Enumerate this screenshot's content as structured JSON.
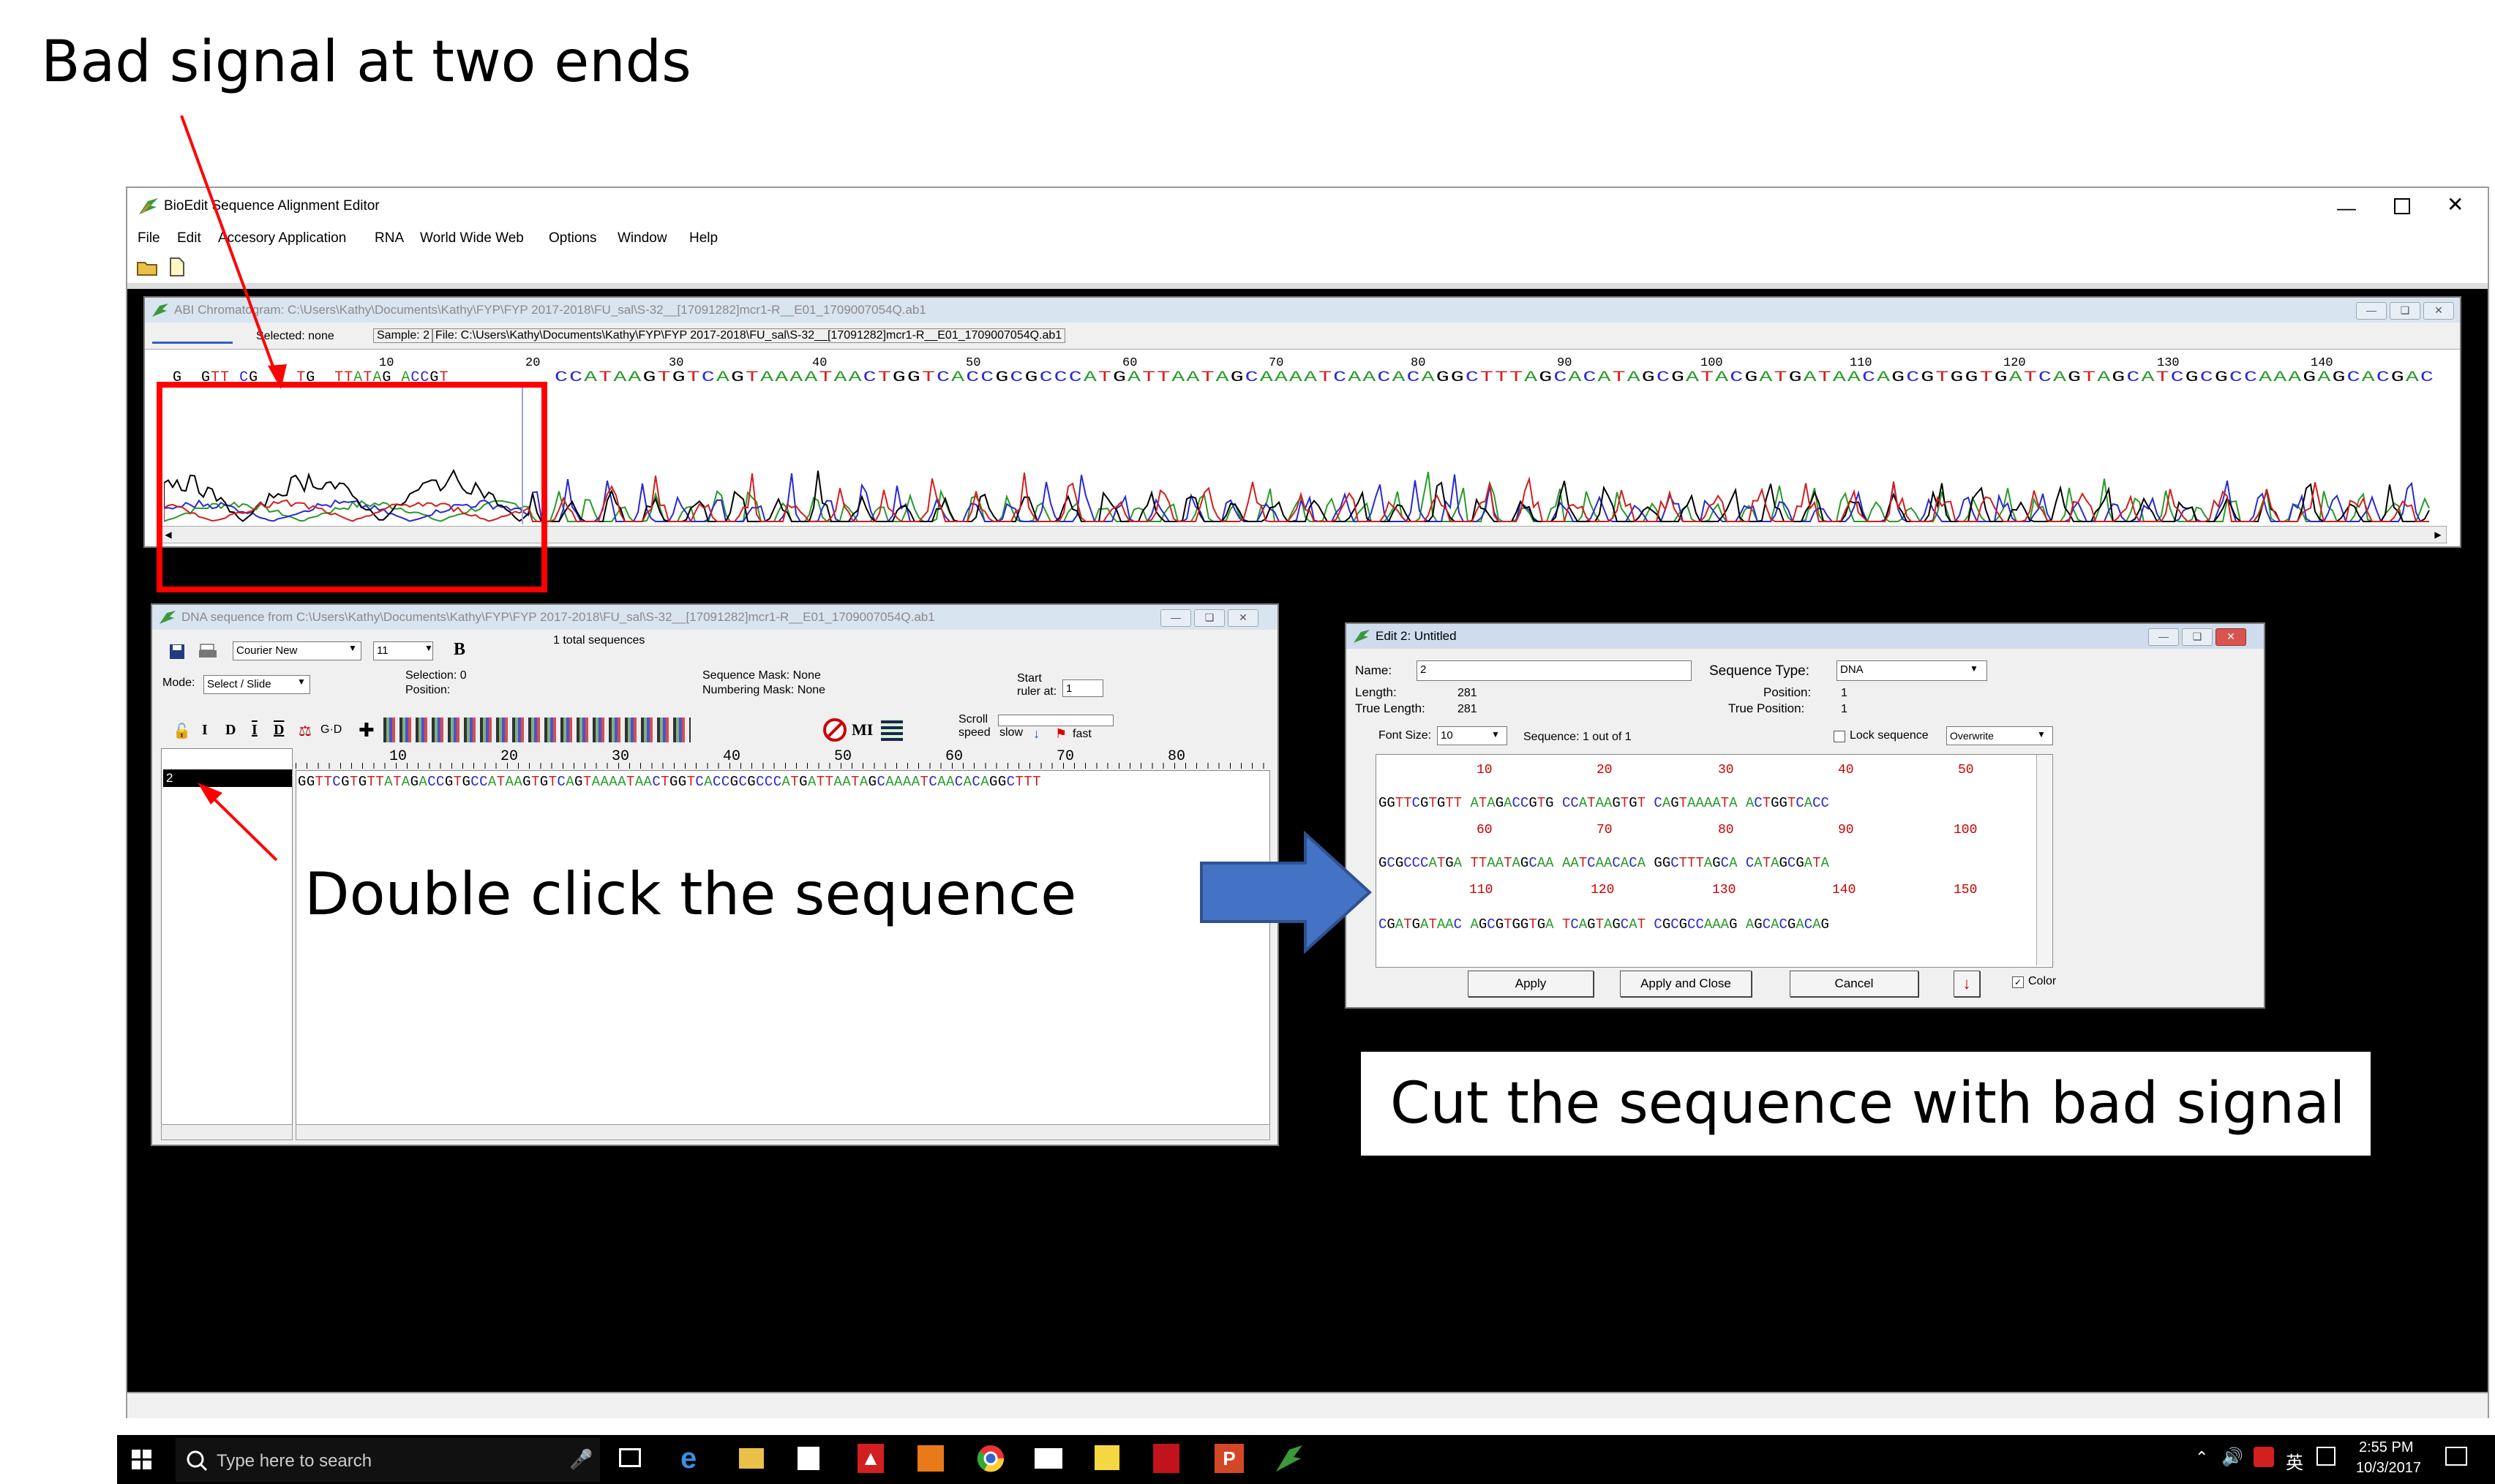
{
  "annotations": {
    "top_left": "Bad signal at two ends",
    "double_click": "Double click the sequence",
    "cut": "Cut the sequence with bad signal"
  },
  "app": {
    "title": "BioEdit Sequence Alignment Editor",
    "menu": [
      "File",
      "Edit",
      "Accesory Application",
      "RNA",
      "World Wide Web",
      "Options",
      "Window",
      "Help"
    ]
  },
  "chromatogram": {
    "title": "ABI Chromatogram: C:\\Users\\Kathy\\Documents\\Kathy\\FYP\\FYP 2017-2018\\FU_sal\\S-32__[17091282]mcr1-R__E01_1709007054Q.ab1",
    "selected": "Selected: none",
    "sample": "Sample: 2",
    "file": "File: C:\\Users\\Kathy\\Documents\\Kathy\\FYP\\FYP 2017-2018\\FU_sal\\S-32__[17091282]mcr1-R__E01_1709007054Q.ab1",
    "ticks": [
      "10",
      "20",
      "30",
      "40",
      "50",
      "60",
      "70",
      "80",
      "90",
      "100",
      "110",
      "120",
      "130",
      "140"
    ],
    "bases_left": "G  GTT CG    TG  TTATAG ACCGT",
    "bases_main": "CCATAAGTGTCAGTAAAATAACTGGTCACCGCGCCCATGATTAATAGCAAAATCAACACAGGCTTTAGCACATAGCGATACGATGATAACAGCGTGGTGATCAGTAGCATCGCGCCAAAGAGCACGAC"
  },
  "dna_window": {
    "title": "DNA sequence from C:\\Users\\Kathy\\Documents\\Kathy\\FYP\\FYP 2017-2018\\FU_sal\\S-32__[17091282]mcr1-R__E01_1709007054Q.ab1",
    "font": "Courier New",
    "font_size": "11",
    "total": "1 total sequences",
    "mode_label": "Mode:",
    "mode": "Select / Slide",
    "selection": "Selection: 0",
    "position": "Position:",
    "seq_mask": "Sequence Mask: None",
    "num_mask": "Numbering Mask: None",
    "start": "Start",
    "ruler_at": "ruler at:",
    "ruler_value": "1",
    "scroll": "Scroll",
    "speed": "speed",
    "slow": "slow",
    "fast": "fast",
    "name": "2",
    "ticks": [
      "10",
      "20",
      "30",
      "40",
      "50",
      "60",
      "70",
      "80"
    ],
    "sequence": "GGTTCGTGTTATAGACCGTGCCATAAGTGTCAGTAAAATAACTGGTCACCGCGCCCATGATTAATAGCAAAATCAACACAGGCTTT"
  },
  "edit_dialog": {
    "title": "Edit 2: Untitled",
    "name_label": "Name:",
    "name_value": "2",
    "seq_type_label": "Sequence Type:",
    "seq_type": "DNA",
    "length_label": "Length:",
    "length": "281",
    "true_length_label": "True Length:",
    "true_length": "281",
    "position_label": "Position:",
    "position": "1",
    "true_position_label": "True Position:",
    "true_position": "1",
    "font_size_label": "Font Size:",
    "font_size": "10",
    "seq_count": "Sequence: 1 out of 1",
    "lock_label": "Lock sequence",
    "overwrite": "Overwrite",
    "rows": [
      {
        "ticks": [
          "10",
          "20",
          "30",
          "40",
          "50"
        ],
        "seq": "GGTTCGTGTT ATAGACCGTG CCATAAGTGT CAGTAAAATA ACTGGTCACC"
      },
      {
        "ticks": [
          "60",
          "70",
          "80",
          "90",
          "100"
        ],
        "seq": "GCGCCCATGA TTAATAGCAA AATCAACACA GGCTTTAGCA CATAGCGATA"
      },
      {
        "ticks": [
          "110",
          "120",
          "130",
          "140",
          "150"
        ],
        "seq": "CGATGATAAC AGCGTGGTGA TCAGTAGCAT CGCGCCAAAG AGCACGACAG"
      }
    ],
    "apply": "Apply",
    "apply_close": "Apply and Close",
    "cancel": "Cancel",
    "color_label": "Color"
  },
  "taskbar": {
    "search": "Type here to search",
    "time": "2:55 PM",
    "date": "10/3/2017",
    "lang": "英"
  },
  "colors": {
    "A": "#2a9a2a",
    "C": "#2a2ad0",
    "G": "#000000",
    "T": "#d02020",
    "red": "#ff0000",
    "arrow": "#4472c4"
  }
}
